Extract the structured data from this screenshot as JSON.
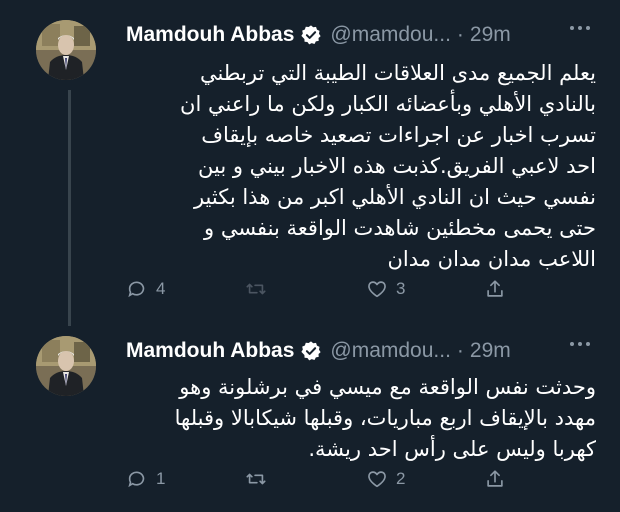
{
  "tweets": [
    {
      "author": "Mamdouh Abbas",
      "handle": "@mamdou...",
      "dot": "·",
      "time": "29m",
      "text": "يعلم الجميع مدى العلاقات الطيبة التي تربطني\nبالنادي الأهلي وبأعضائه الكبار ولكن ما راعني ان\nتسرب اخبار عن اجراءات تصعيد خاصه بإيقاف\nاحد لاعبي الفريق.كذبت هذه الاخبار بيني و بين\nنفسي حيث ان النادي الأهلي اكبر من هذا بكثير\nحتى يحمى مخطئين شاهدت الواقعة بنفسي و\nاللاعب مدان مدان مدان",
      "replies": "4",
      "retweets": "",
      "likes": "3"
    },
    {
      "author": "Mamdouh Abbas",
      "handle": "@mamdou...",
      "dot": "·",
      "time": "29m",
      "text": "وحدثت نفس الواقعة مع ميسي في برشلونة وهو\nمهدد بالإيقاف اربع مباريات، وقبلها شيكابالا وقبلها\nكهربا وليس على رأس احد ريشة.",
      "replies": "1",
      "retweets": "",
      "likes": "2"
    }
  ],
  "icons": {
    "reply": "reply-icon",
    "retweet": "retweet-icon",
    "like": "heart-icon",
    "share": "share-icon",
    "verified": "verified-badge-icon",
    "more": "more-icon"
  },
  "colors": {
    "background": "#15202b",
    "text": "#ffffff",
    "secondary": "#8b98a5",
    "verified": "#ffffff",
    "thread_line": "#38444d"
  }
}
